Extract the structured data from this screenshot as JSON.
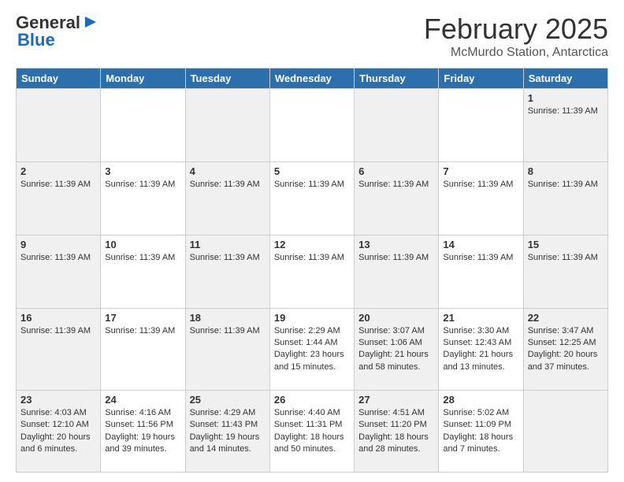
{
  "header": {
    "logo_general": "General",
    "logo_blue": "Blue",
    "month_title": "February 2025",
    "location": "McMurdo Station, Antarctica"
  },
  "weekdays": [
    "Sunday",
    "Monday",
    "Tuesday",
    "Wednesday",
    "Thursday",
    "Friday",
    "Saturday"
  ],
  "weeks": [
    [
      {
        "day": "",
        "info": ""
      },
      {
        "day": "",
        "info": ""
      },
      {
        "day": "",
        "info": ""
      },
      {
        "day": "",
        "info": ""
      },
      {
        "day": "",
        "info": ""
      },
      {
        "day": "",
        "info": ""
      },
      {
        "day": "1",
        "info": "Sunrise: 11:39 AM"
      }
    ],
    [
      {
        "day": "2",
        "info": "Sunrise: 11:39 AM"
      },
      {
        "day": "3",
        "info": "Sunrise: 11:39 AM"
      },
      {
        "day": "4",
        "info": "Sunrise: 11:39 AM"
      },
      {
        "day": "5",
        "info": "Sunrise: 11:39 AM"
      },
      {
        "day": "6",
        "info": "Sunrise: 11:39 AM"
      },
      {
        "day": "7",
        "info": "Sunrise: 11:39 AM"
      },
      {
        "day": "8",
        "info": "Sunrise: 11:39 AM"
      }
    ],
    [
      {
        "day": "9",
        "info": "Sunrise: 11:39 AM"
      },
      {
        "day": "10",
        "info": "Sunrise: 11:39 AM"
      },
      {
        "day": "11",
        "info": "Sunrise: 11:39 AM"
      },
      {
        "day": "12",
        "info": "Sunrise: 11:39 AM"
      },
      {
        "day": "13",
        "info": "Sunrise: 11:39 AM"
      },
      {
        "day": "14",
        "info": "Sunrise: 11:39 AM"
      },
      {
        "day": "15",
        "info": "Sunrise: 11:39 AM"
      }
    ],
    [
      {
        "day": "16",
        "info": "Sunrise: 11:39 AM"
      },
      {
        "day": "17",
        "info": "Sunrise: 11:39 AM"
      },
      {
        "day": "18",
        "info": "Sunrise: 11:39 AM"
      },
      {
        "day": "19",
        "info": "Sunrise: 2:29 AM\nSunset: 1:44 AM\nDaylight: 23 hours and 15 minutes."
      },
      {
        "day": "20",
        "info": "Sunrise: 3:07 AM\nSunset: 1:06 AM\nDaylight: 21 hours and 58 minutes."
      },
      {
        "day": "21",
        "info": "Sunrise: 3:30 AM\nSunset: 12:43 AM\nDaylight: 21 hours and 13 minutes."
      },
      {
        "day": "22",
        "info": "Sunrise: 3:47 AM\nSunset: 12:25 AM\nDaylight: 20 hours and 37 minutes."
      }
    ],
    [
      {
        "day": "23",
        "info": "Sunrise: 4:03 AM\nSunset: 12:10 AM\nDaylight: 20 hours and 6 minutes."
      },
      {
        "day": "24",
        "info": "Sunrise: 4:16 AM\nSunset: 11:56 PM\nDaylight: 19 hours and 39 minutes."
      },
      {
        "day": "25",
        "info": "Sunrise: 4:29 AM\nSunset: 11:43 PM\nDaylight: 19 hours and 14 minutes."
      },
      {
        "day": "26",
        "info": "Sunrise: 4:40 AM\nSunset: 11:31 PM\nDaylight: 18 hours and 50 minutes."
      },
      {
        "day": "27",
        "info": "Sunrise: 4:51 AM\nSunset: 11:20 PM\nDaylight: 18 hours and 28 minutes."
      },
      {
        "day": "28",
        "info": "Sunrise: 5:02 AM\nSunset: 11:09 PM\nDaylight: 18 hours and 7 minutes."
      },
      {
        "day": "",
        "info": ""
      }
    ]
  ]
}
